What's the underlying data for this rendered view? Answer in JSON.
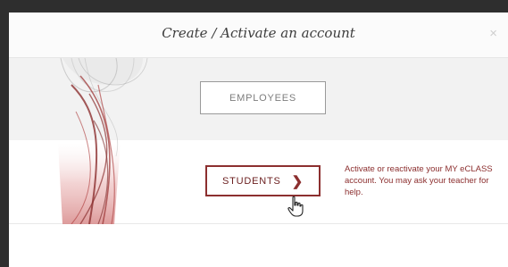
{
  "modal": {
    "title": "Create / Activate an account",
    "close_symbol": "×",
    "employees_label": "EMPLOYEES",
    "students_label": "STUDENTS",
    "students_chevron": "❯",
    "students_description": "Activate or reactivate your MY eCLASS account. You may ask your teacher for help."
  },
  "colors": {
    "accent": "#8c2f2f",
    "header_bg": "#fbfbfb",
    "band_bg": "#f2f2f2"
  },
  "icons": {
    "close": "close-icon",
    "chevron": "chevron-right-icon",
    "cursor": "hand-pointer-icon"
  }
}
